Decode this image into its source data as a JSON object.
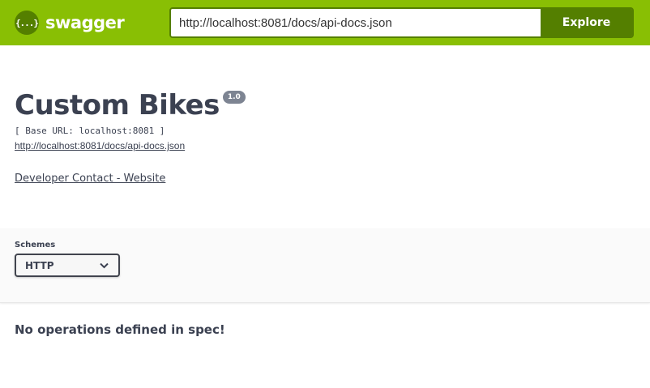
{
  "topbar": {
    "logo_icon": "swagger-braces-icon",
    "logo_glyph": "{...}",
    "brand": "swagger",
    "url_value": "http://localhost:8081/docs/api-docs.json",
    "explore_label": "Explore",
    "colors": {
      "bar": "#89bf04",
      "dark": "#547f00"
    }
  },
  "info": {
    "title": "Custom Bikes",
    "version": "1.0",
    "base_url": "[ Base URL: localhost:8081 ]",
    "spec_url": "http://localhost:8081/docs/api-docs.json",
    "contact": "Developer Contact - Website"
  },
  "schemes": {
    "label": "Schemes",
    "selected": "HTTP",
    "icon": "chevron-down-icon"
  },
  "operations": {
    "empty_message": "No operations defined in spec!"
  }
}
